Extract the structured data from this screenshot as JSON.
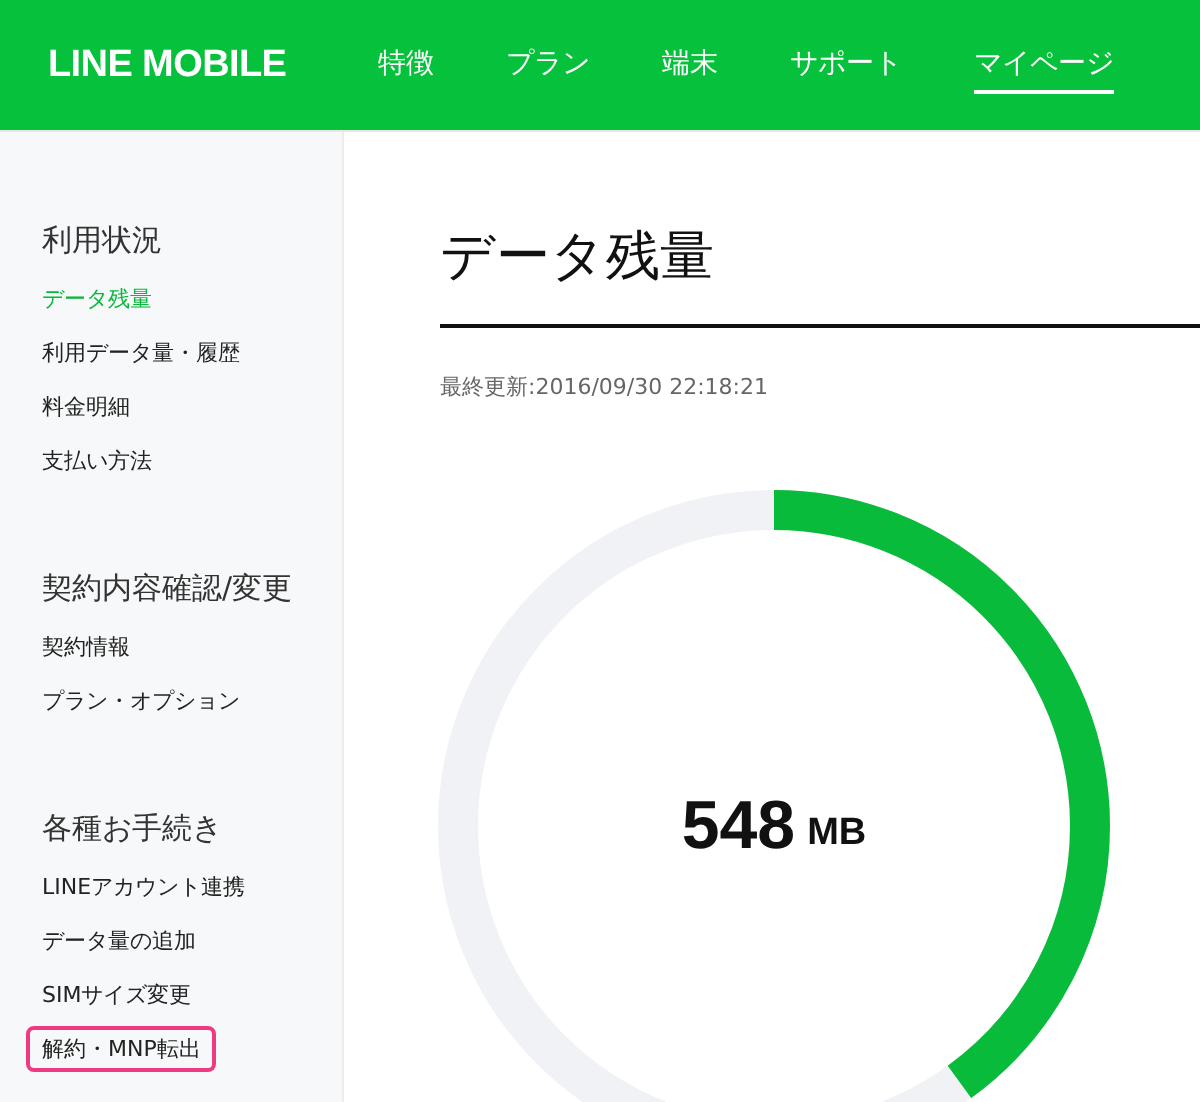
{
  "header": {
    "logo": "LINE MOBILE",
    "nav": [
      {
        "label": "特徴",
        "selected": false
      },
      {
        "label": "プラン",
        "selected": false
      },
      {
        "label": "端末",
        "selected": false
      },
      {
        "label": "サポート",
        "selected": false
      },
      {
        "label": "マイページ",
        "selected": true
      }
    ]
  },
  "sidebar": {
    "sections": [
      {
        "title": "利用状況",
        "items": [
          {
            "label": "データ残量",
            "selected": true,
            "highlighted": false
          },
          {
            "label": "利用データ量・履歴",
            "selected": false,
            "highlighted": false
          },
          {
            "label": "料金明細",
            "selected": false,
            "highlighted": false
          },
          {
            "label": "支払い方法",
            "selected": false,
            "highlighted": false
          }
        ]
      },
      {
        "title": "契約内容確認/変更",
        "items": [
          {
            "label": "契約情報",
            "selected": false,
            "highlighted": false
          },
          {
            "label": "プラン・オプション",
            "selected": false,
            "highlighted": false
          }
        ]
      },
      {
        "title": "各種お手続き",
        "items": [
          {
            "label": "LINEアカウント連携",
            "selected": false,
            "highlighted": false
          },
          {
            "label": "データ量の追加",
            "selected": false,
            "highlighted": false
          },
          {
            "label": "SIMサイズ変更",
            "selected": false,
            "highlighted": false
          },
          {
            "label": "解約・MNP転出",
            "selected": false,
            "highlighted": true
          }
        ]
      }
    ]
  },
  "main": {
    "title": "データ残量",
    "updated": "最終更新:2016/09/30 22:18:21",
    "gauge": {
      "level": 0.4,
      "value": "548",
      "unit": "MB"
    }
  }
}
